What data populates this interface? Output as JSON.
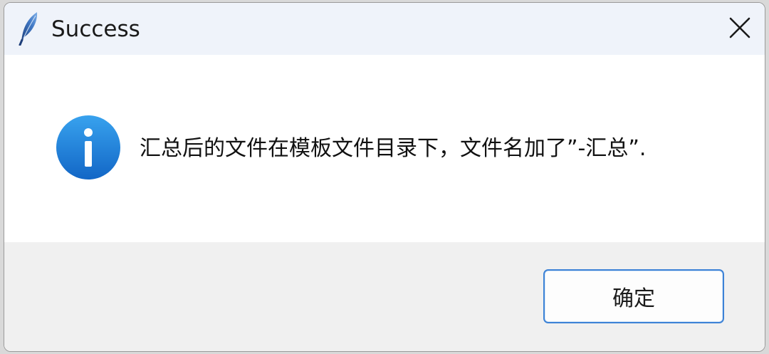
{
  "window": {
    "title": "Success",
    "app_icon": "feather-icon",
    "close_icon": "close-icon"
  },
  "message": {
    "icon": "info-icon",
    "text": "汇总后的文件在模板文件目录下，文件名加了”-汇总”."
  },
  "buttons": {
    "ok_label": "确定"
  },
  "colors": {
    "titlebar": "#eff3fa",
    "footer": "#f0f0f0",
    "info_blue": "#1a7fd8",
    "button_border": "#3c82d6"
  }
}
